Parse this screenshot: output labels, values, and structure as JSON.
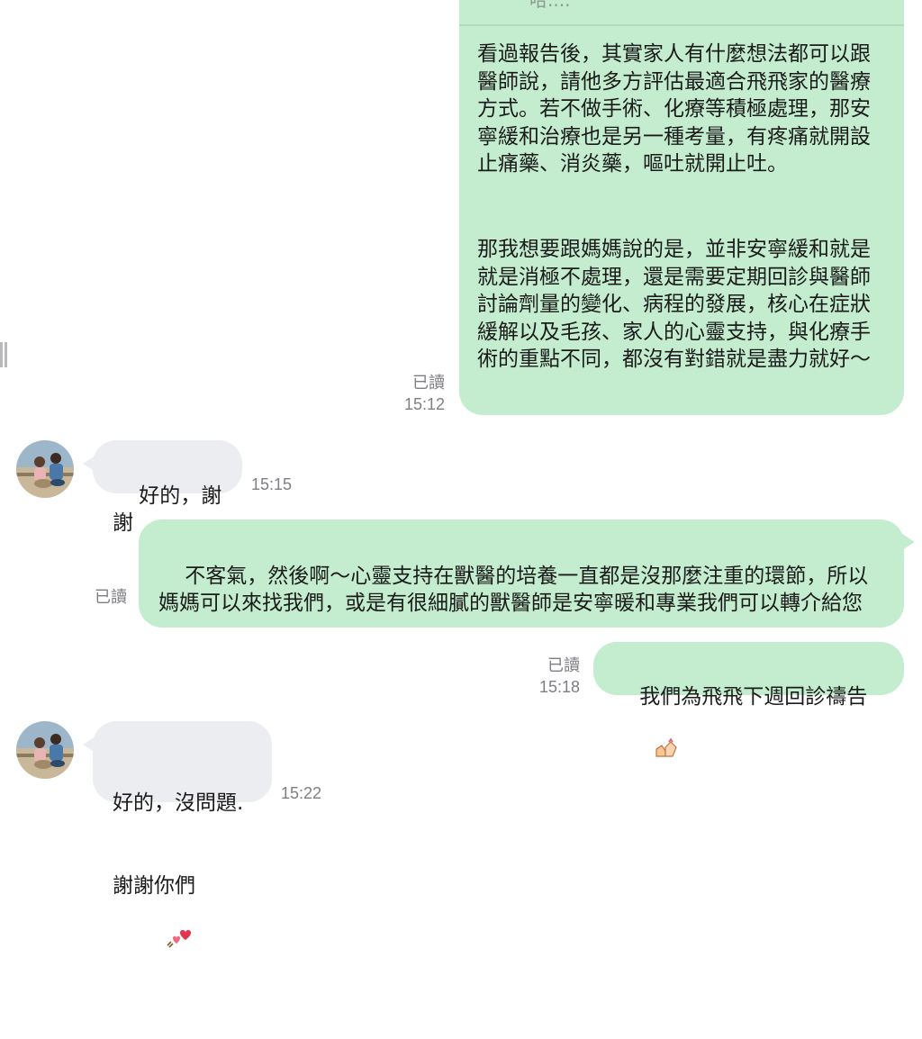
{
  "colors": {
    "outgoing_bubble": "#c4edcf",
    "incoming_bubble": "#ecedf1",
    "meta_text": "#7e7e84",
    "background": "#ffffff"
  },
  "messages": {
    "m1": {
      "cut_text": "哈....",
      "paragraph1": "看過報告後，其實家人有什麼想法都可以跟醫師說，請他多方評估最適合飛飛家的醫療方式。若不做手術、化療等積極處理，那安寧緩和治療也是另一種考量，有疼痛就開設止痛藥、消炎藥，嘔吐就開止吐。",
      "paragraph2": "那我想要跟媽媽說的是，並非安寧緩和就是就是消極不處理，還是需要定期回診與醫師討論劑量的變化、病程的發展，核心在症狀緩解以及毛孩、家人的心靈支持，與化療手術的重點不同，都沒有對錯就是盡力就好～",
      "read": "已讀",
      "time": "15:12"
    },
    "m2": {
      "text": "好的，謝謝",
      "time": "15:15",
      "avatar_icon": "profile-photo-icon"
    },
    "m3": {
      "text": "不客氣，然後啊～心靈支持在獸醫的培養一直都是沒那麼注重的環節，所以媽媽可以來找我們，或是有很細膩的獸醫師是安寧暖和專業我們可以轉介給您",
      "read": "已讀"
    },
    "m4": {
      "text": "我們為飛飛下週回診禱告",
      "emoji_icon": "praying-hands-emoji-icon",
      "read": "已讀",
      "time": "15:18"
    },
    "m5": {
      "line1": "好的，沒問題.",
      "line2": "謝謝你們",
      "emoji_icon": "hearts-emoji-icon",
      "time": "15:22",
      "avatar_icon": "profile-photo-icon"
    }
  }
}
